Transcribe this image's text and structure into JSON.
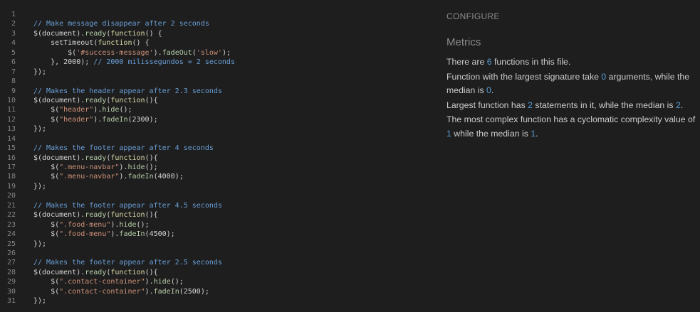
{
  "editor": {
    "lines": [
      {
        "n": "1",
        "tokens": []
      },
      {
        "n": "2",
        "tokens": [
          {
            "c": "c",
            "t": "// Make message disappear after 2 seconds"
          }
        ]
      },
      {
        "n": "3",
        "tokens": [
          {
            "c": "p",
            "t": "$(document)."
          },
          {
            "c": "f",
            "t": "ready"
          },
          {
            "c": "p",
            "t": "("
          },
          {
            "c": "m",
            "t": "function"
          },
          {
            "c": "p",
            "t": "() {"
          }
        ]
      },
      {
        "n": "4",
        "tokens": [
          {
            "c": "p",
            "t": "    setTimeout("
          },
          {
            "c": "m",
            "t": "function"
          },
          {
            "c": "p",
            "t": "() {"
          }
        ]
      },
      {
        "n": "5",
        "tokens": [
          {
            "c": "p",
            "t": "        $("
          },
          {
            "c": "s",
            "t": "'#success-message'"
          },
          {
            "c": "p",
            "t": ")."
          },
          {
            "c": "f",
            "t": "fadeOut"
          },
          {
            "c": "p",
            "t": "("
          },
          {
            "c": "s",
            "t": "'slow'"
          },
          {
            "c": "p",
            "t": ");"
          }
        ]
      },
      {
        "n": "6",
        "tokens": [
          {
            "c": "p",
            "t": "    }, 2000); "
          },
          {
            "c": "c",
            "t": "// 2000 milissegundos = 2 seconds"
          }
        ]
      },
      {
        "n": "7",
        "tokens": [
          {
            "c": "p",
            "t": "});"
          }
        ]
      },
      {
        "n": "8",
        "tokens": []
      },
      {
        "n": "9",
        "tokens": [
          {
            "c": "c",
            "t": "// Makes the header appear after 2.3 seconds"
          }
        ]
      },
      {
        "n": "10",
        "tokens": [
          {
            "c": "p",
            "t": "$(document)."
          },
          {
            "c": "f",
            "t": "ready"
          },
          {
            "c": "p",
            "t": "("
          },
          {
            "c": "m",
            "t": "function"
          },
          {
            "c": "p",
            "t": "(){"
          }
        ]
      },
      {
        "n": "11",
        "tokens": [
          {
            "c": "p",
            "t": "    $("
          },
          {
            "c": "s",
            "t": "\"header\""
          },
          {
            "c": "p",
            "t": ")."
          },
          {
            "c": "f",
            "t": "hide"
          },
          {
            "c": "p",
            "t": "();"
          }
        ]
      },
      {
        "n": "12",
        "tokens": [
          {
            "c": "p",
            "t": "    $("
          },
          {
            "c": "s",
            "t": "\"header\""
          },
          {
            "c": "p",
            "t": ")."
          },
          {
            "c": "f",
            "t": "fadeIn"
          },
          {
            "c": "p",
            "t": "(2300);"
          }
        ]
      },
      {
        "n": "13",
        "tokens": [
          {
            "c": "p",
            "t": "});"
          }
        ]
      },
      {
        "n": "14",
        "tokens": []
      },
      {
        "n": "15",
        "tokens": [
          {
            "c": "c",
            "t": "// Makes the footer appear after 4 seconds"
          }
        ]
      },
      {
        "n": "16",
        "tokens": [
          {
            "c": "p",
            "t": "$(document)."
          },
          {
            "c": "f",
            "t": "ready"
          },
          {
            "c": "p",
            "t": "("
          },
          {
            "c": "m",
            "t": "function"
          },
          {
            "c": "p",
            "t": "(){"
          }
        ]
      },
      {
        "n": "17",
        "tokens": [
          {
            "c": "p",
            "t": "    $("
          },
          {
            "c": "s",
            "t": "\".menu-navbar\""
          },
          {
            "c": "p",
            "t": ")."
          },
          {
            "c": "f",
            "t": "hide"
          },
          {
            "c": "p",
            "t": "();"
          }
        ]
      },
      {
        "n": "18",
        "tokens": [
          {
            "c": "p",
            "t": "    $("
          },
          {
            "c": "s",
            "t": "\".menu-navbar\""
          },
          {
            "c": "p",
            "t": ")."
          },
          {
            "c": "f",
            "t": "fadeIn"
          },
          {
            "c": "p",
            "t": "(4000);"
          }
        ]
      },
      {
        "n": "19",
        "tokens": [
          {
            "c": "p",
            "t": "});"
          }
        ]
      },
      {
        "n": "20",
        "tokens": []
      },
      {
        "n": "21",
        "tokens": [
          {
            "c": "c",
            "t": "// Makes the footer appear after 4.5 seconds"
          }
        ]
      },
      {
        "n": "22",
        "tokens": [
          {
            "c": "p",
            "t": "$(document)."
          },
          {
            "c": "f",
            "t": "ready"
          },
          {
            "c": "p",
            "t": "("
          },
          {
            "c": "m",
            "t": "function"
          },
          {
            "c": "p",
            "t": "(){"
          }
        ]
      },
      {
        "n": "23",
        "tokens": [
          {
            "c": "p",
            "t": "    $("
          },
          {
            "c": "s",
            "t": "\".food-menu\""
          },
          {
            "c": "p",
            "t": ")."
          },
          {
            "c": "f",
            "t": "hide"
          },
          {
            "c": "p",
            "t": "();"
          }
        ]
      },
      {
        "n": "24",
        "tokens": [
          {
            "c": "p",
            "t": "    $("
          },
          {
            "c": "s",
            "t": "\".food-menu\""
          },
          {
            "c": "p",
            "t": ")."
          },
          {
            "c": "f",
            "t": "fadeIn"
          },
          {
            "c": "p",
            "t": "(4500);"
          }
        ]
      },
      {
        "n": "25",
        "tokens": [
          {
            "c": "p",
            "t": "});"
          }
        ]
      },
      {
        "n": "26",
        "tokens": []
      },
      {
        "n": "27",
        "tokens": [
          {
            "c": "c",
            "t": "// Makes the footer appear after 2.5 seconds"
          }
        ]
      },
      {
        "n": "28",
        "tokens": [
          {
            "c": "p",
            "t": "$(document)."
          },
          {
            "c": "f",
            "t": "ready"
          },
          {
            "c": "p",
            "t": "("
          },
          {
            "c": "m",
            "t": "function"
          },
          {
            "c": "p",
            "t": "(){"
          }
        ]
      },
      {
        "n": "29",
        "tokens": [
          {
            "c": "p",
            "t": "    $("
          },
          {
            "c": "s",
            "t": "\".contact-container\""
          },
          {
            "c": "p",
            "t": ")."
          },
          {
            "c": "f",
            "t": "hide"
          },
          {
            "c": "p",
            "t": "();"
          }
        ]
      },
      {
        "n": "30",
        "tokens": [
          {
            "c": "p",
            "t": "    $("
          },
          {
            "c": "s",
            "t": "\".contact-container\""
          },
          {
            "c": "p",
            "t": ")."
          },
          {
            "c": "f",
            "t": "fadeIn"
          },
          {
            "c": "p",
            "t": "(2500);"
          }
        ]
      },
      {
        "n": "31",
        "tokens": [
          {
            "c": "p",
            "t": "});"
          }
        ]
      }
    ]
  },
  "panel": {
    "configure_label": "CONFIGURE",
    "metrics_heading": "Metrics",
    "metrics": [
      {
        "parts": [
          {
            "t": "There are "
          },
          {
            "t": "6",
            "num": true
          },
          {
            "t": " functions in this file."
          }
        ]
      },
      {
        "parts": [
          {
            "t": "Function with the largest signature take "
          },
          {
            "t": "0",
            "num": true
          },
          {
            "t": " arguments, while the median is "
          },
          {
            "t": "0",
            "num": true
          },
          {
            "t": "."
          }
        ]
      },
      {
        "parts": [
          {
            "t": "Largest function has "
          },
          {
            "t": "2",
            "num": true
          },
          {
            "t": " statements in it, while the median is "
          },
          {
            "t": "2",
            "num": true
          },
          {
            "t": "."
          }
        ]
      },
      {
        "parts": [
          {
            "t": "The most complex function has a cyclomatic complexity value of "
          },
          {
            "t": "1",
            "num": true
          },
          {
            "t": " while the median is "
          },
          {
            "t": "1",
            "num": true
          },
          {
            "t": "."
          }
        ]
      }
    ]
  }
}
